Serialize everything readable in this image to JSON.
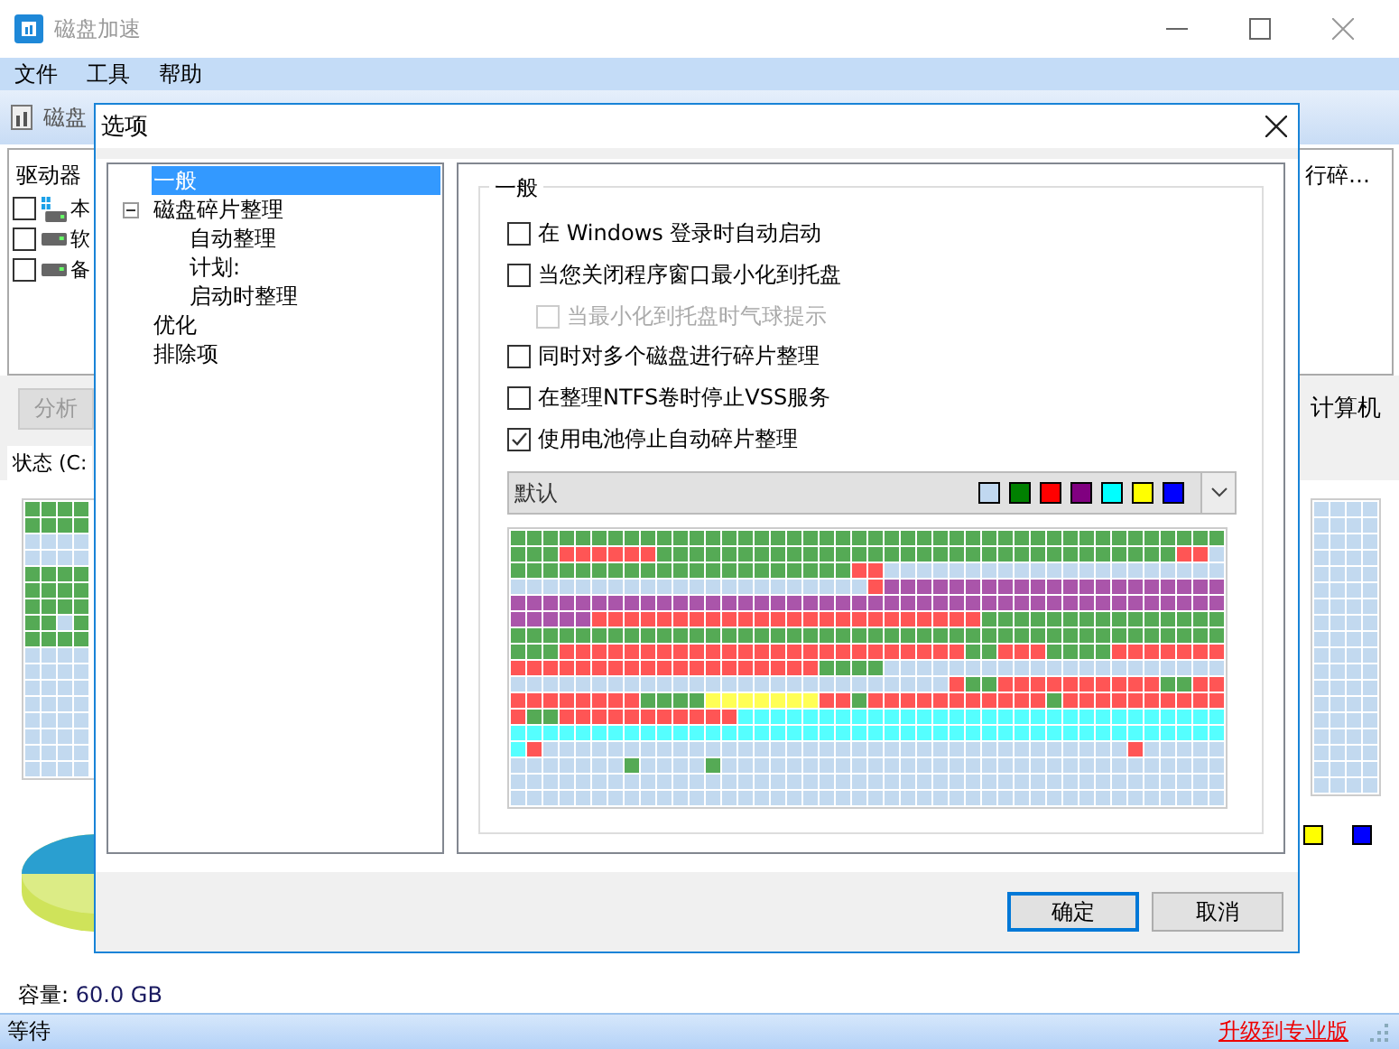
{
  "window": {
    "title": "磁盘加速",
    "menu": [
      "文件",
      "工具",
      "帮助"
    ],
    "toolbar_label": "磁盘"
  },
  "drive_list": {
    "header": "驱动器",
    "header_right": "行碎…",
    "items": [
      {
        "label": "本",
        "checked": false,
        "kind": "system"
      },
      {
        "label": "软",
        "checked": false,
        "kind": "drive"
      },
      {
        "label": "备",
        "checked": false,
        "kind": "drive"
      }
    ]
  },
  "analyze_button": {
    "label": "分析",
    "disabled": true
  },
  "right_button": "计算机",
  "tab": "状态 (C:",
  "legend": [
    {
      "color": "#ffff00"
    },
    {
      "color": "#0000ff"
    }
  ],
  "capacity": {
    "label": "容量:",
    "value": "60.0 GB"
  },
  "status_bar": {
    "text": "等待",
    "upgrade_link": "升级到专业版"
  },
  "dialog": {
    "title": "选项",
    "tree": [
      {
        "label": "一般",
        "selected": true
      },
      {
        "label": "磁盘碎片整理",
        "selected": false,
        "expanded": true,
        "children": [
          {
            "label": "自动整理",
            "selected": false
          },
          {
            "label": "计划:",
            "selected": false
          },
          {
            "label": "启动时整理",
            "selected": false
          }
        ]
      },
      {
        "label": "优化",
        "selected": false
      },
      {
        "label": "排除项",
        "selected": false
      }
    ],
    "group_title": "一般",
    "options": [
      {
        "label": "在 Windows 登录时自动启动",
        "checked": false,
        "disabled": false
      },
      {
        "label": "当您关闭程序窗口最小化到托盘",
        "checked": false,
        "disabled": false,
        "children": [
          {
            "label": "当最小化到托盘时气球提示",
            "checked": false,
            "disabled": true
          }
        ]
      },
      {
        "label": "同时对多个磁盘进行碎片整理",
        "checked": false,
        "disabled": false
      },
      {
        "label": "在整理NTFS卷时停止VSS服务",
        "checked": false,
        "disabled": false
      },
      {
        "label": "使用电池停止自动碎片整理",
        "checked": true,
        "disabled": false
      }
    ],
    "scheme": {
      "value": "默认",
      "colors": [
        {
          "color": "#c0d8f0"
        },
        {
          "color": "#008000"
        },
        {
          "color": "#ff0000"
        },
        {
          "color": "#800080"
        },
        {
          "color": "#00ffff"
        },
        {
          "color": "#ffff00"
        },
        {
          "color": "#0000ff"
        }
      ]
    },
    "buttons": [
      {
        "label": "确定",
        "kind": "default"
      },
      {
        "label": "取消",
        "kind": "normal"
      }
    ]
  }
}
